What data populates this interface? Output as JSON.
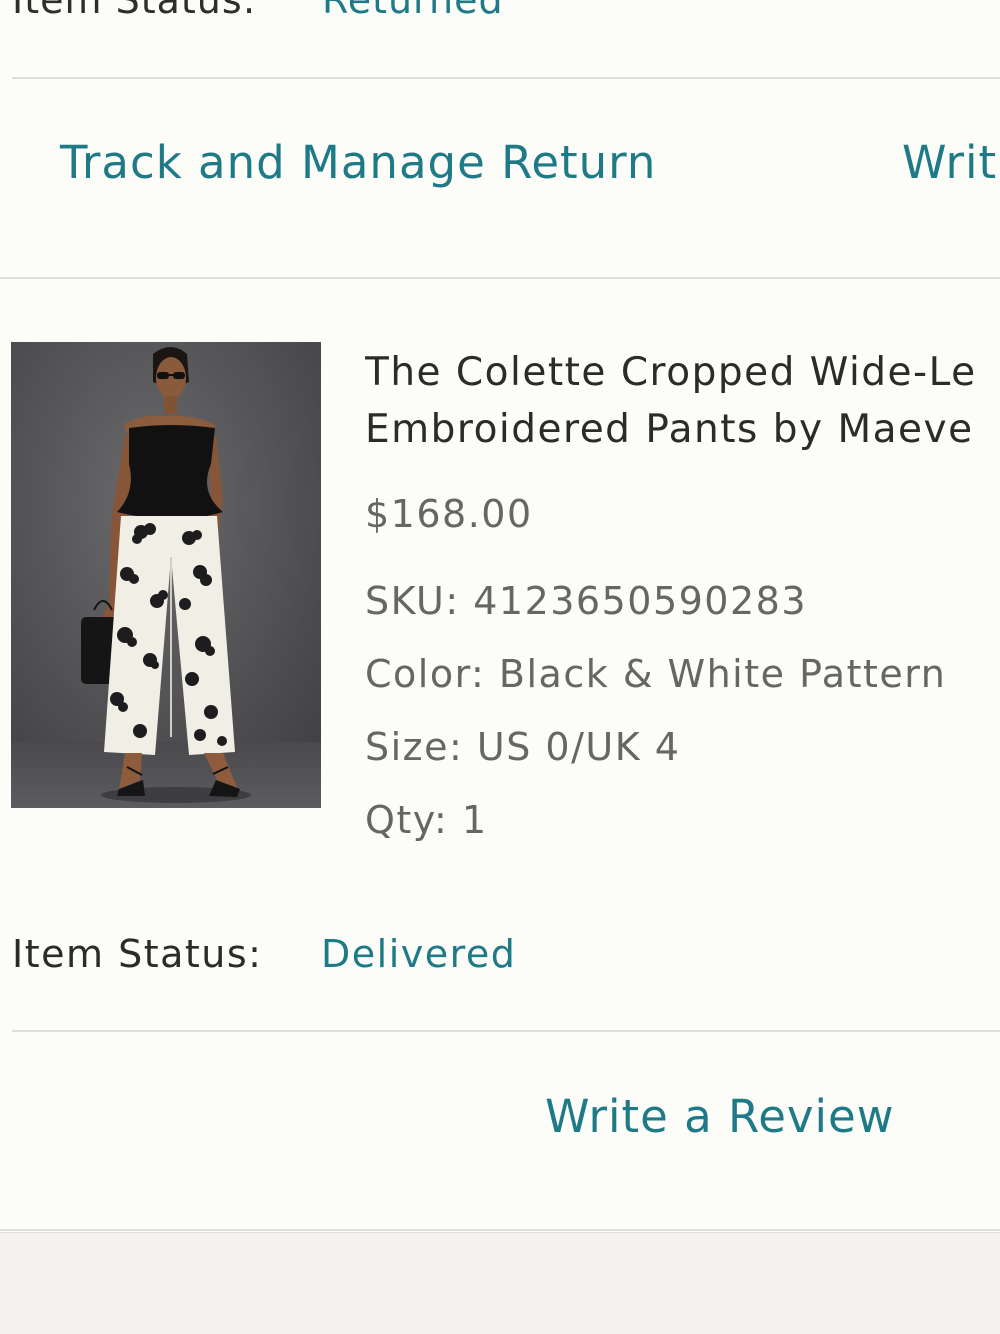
{
  "previous_item": {
    "status_label": "Item Status:",
    "status_value": "Returned"
  },
  "previous_actions": {
    "track_return_label": "Track and Manage Return",
    "write_review_label": "Writ"
  },
  "product": {
    "title_line1": "The Colette Cropped Wide-Le",
    "title_line2": "Embroidered Pants by Maeve",
    "price": "$168.00",
    "sku": "SKU: 4123650590283",
    "color": "Color: Black & White Pattern",
    "size": "Size: US 0/UK 4",
    "qty": "Qty: 1",
    "status_label": "Item Status:",
    "status_value": "Delivered",
    "write_review_label": "Write a Review"
  },
  "colors": {
    "accent": "#1f7a88",
    "background": "#fcfcf8",
    "text": "#2b2b2b",
    "muted_text": "#666666",
    "divider": "#dddddb",
    "footer": "#f3f2f0"
  }
}
